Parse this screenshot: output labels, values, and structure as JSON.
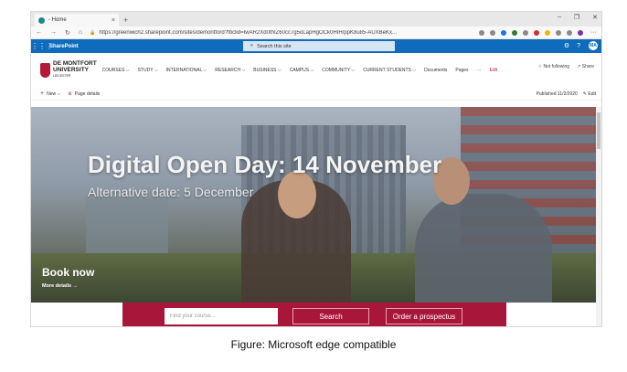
{
  "browser": {
    "tab_title": "- Home",
    "tab_close": "×",
    "new_tab": "+",
    "window_controls": [
      "–",
      "❐",
      "✕"
    ],
    "nav_icons": [
      "←",
      "→",
      "↻",
      "⌂"
    ],
    "url": "https://greenwich2.sharepoint.com/sites/demontford?fbclid=IwAR2Xd0thIZ60cc7g5oLapHgOCk0HIH/ppK8u85-AUXBeKx...",
    "lock_icon": "🔒",
    "ext_colors": [
      "#8a8a8a",
      "#8a8a8a",
      "#1a73e8",
      "#2e7d32",
      "#8a8a8a",
      "#d32f2f",
      "#f2b705",
      "#8a8a8a",
      "#8a8a8a",
      "#7b2fa0"
    ],
    "menu": "···"
  },
  "suite": {
    "waffle": "⋮⋮⋮",
    "app_name": "SharePoint",
    "search_icon": "⌕",
    "search_placeholder": "Search this site",
    "settings": "⚙",
    "help": "?",
    "avatar": "MA",
    "color": "#0f6cbd"
  },
  "site": {
    "logo_line1": "DE MONTFORT",
    "logo_line2": "UNIVERSITY",
    "logo_line3": "LEICESTER",
    "nav": [
      {
        "label": "COURSES ⌵"
      },
      {
        "label": "STUDY ⌵"
      },
      {
        "label": "INTERNATIONAL ⌵"
      },
      {
        "label": "RESEARCH ⌵"
      },
      {
        "label": "BUSINESS ⌵"
      },
      {
        "label": "CAMPUS ⌵"
      },
      {
        "label": "COMMUNITY ⌵"
      },
      {
        "label": "CURRENT STUDENTS ⌵"
      },
      {
        "label": "Documents"
      },
      {
        "label": "Pages"
      },
      {
        "label": "···"
      }
    ],
    "edit": "Edit",
    "not_following": "☆ Not following",
    "share": "↗ Share",
    "accent": "#b5173a"
  },
  "cmdbar": {
    "new": "New ⌵",
    "page_details": "Page details",
    "published": "Published 11/2/2020",
    "edit": "✎ Edit"
  },
  "hero": {
    "title": "Digital Open Day: 14 November",
    "subtitle": "Alternative date: 5 December",
    "book_now": "Book now",
    "more_details": "More details →"
  },
  "strip": {
    "find_placeholder": "Find your course...",
    "search_label": "Search",
    "prospectus_label": "Order a prospectus",
    "color": "#a8173a"
  },
  "caption": "Figure: Microsoft edge compatible"
}
